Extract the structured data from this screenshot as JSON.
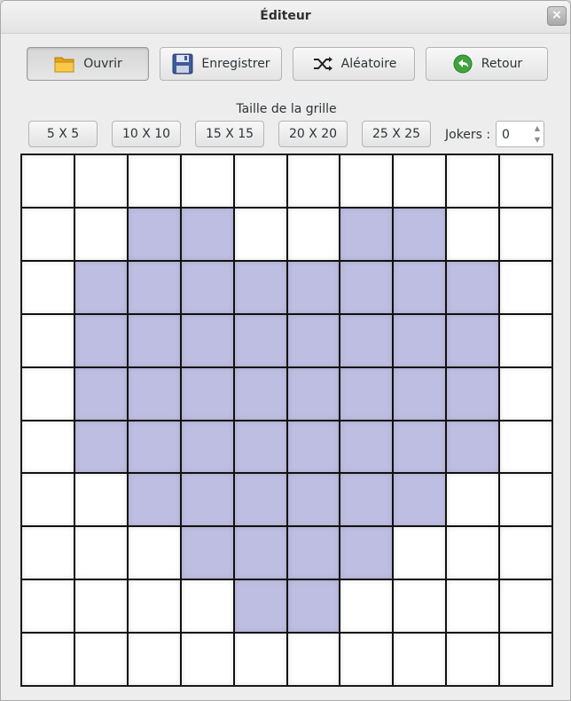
{
  "window": {
    "title": "Éditeur",
    "close_symbol": "×"
  },
  "toolbar": {
    "open_label": "Ouvrir",
    "save_label": "Enregistrer",
    "random_label": "Aléatoire",
    "back_label": "Retour"
  },
  "grid_size": {
    "label": "Taille de la grille",
    "options": [
      "5 X 5",
      "10 X 10",
      "15 X 15",
      "20 X 20",
      "25 X 25"
    ]
  },
  "jokers": {
    "label": "Jokers :",
    "value": "0"
  },
  "colors": {
    "filled": "#bebee2",
    "empty": "#ffffff",
    "grid_line": "#111111"
  },
  "grid": {
    "cells": [
      [
        0,
        0,
        0,
        0,
        0,
        0,
        0,
        0,
        0,
        0
      ],
      [
        0,
        0,
        1,
        1,
        0,
        0,
        1,
        1,
        0,
        0
      ],
      [
        0,
        1,
        1,
        1,
        1,
        1,
        1,
        1,
        1,
        0
      ],
      [
        0,
        1,
        1,
        1,
        1,
        1,
        1,
        1,
        1,
        0
      ],
      [
        0,
        1,
        1,
        1,
        1,
        1,
        1,
        1,
        1,
        0
      ],
      [
        0,
        1,
        1,
        1,
        1,
        1,
        1,
        1,
        1,
        0
      ],
      [
        0,
        0,
        1,
        1,
        1,
        1,
        1,
        1,
        0,
        0
      ],
      [
        0,
        0,
        0,
        1,
        1,
        1,
        1,
        0,
        0,
        0
      ],
      [
        0,
        0,
        0,
        0,
        1,
        1,
        0,
        0,
        0,
        0
      ],
      [
        0,
        0,
        0,
        0,
        0,
        0,
        0,
        0,
        0,
        0
      ]
    ]
  }
}
